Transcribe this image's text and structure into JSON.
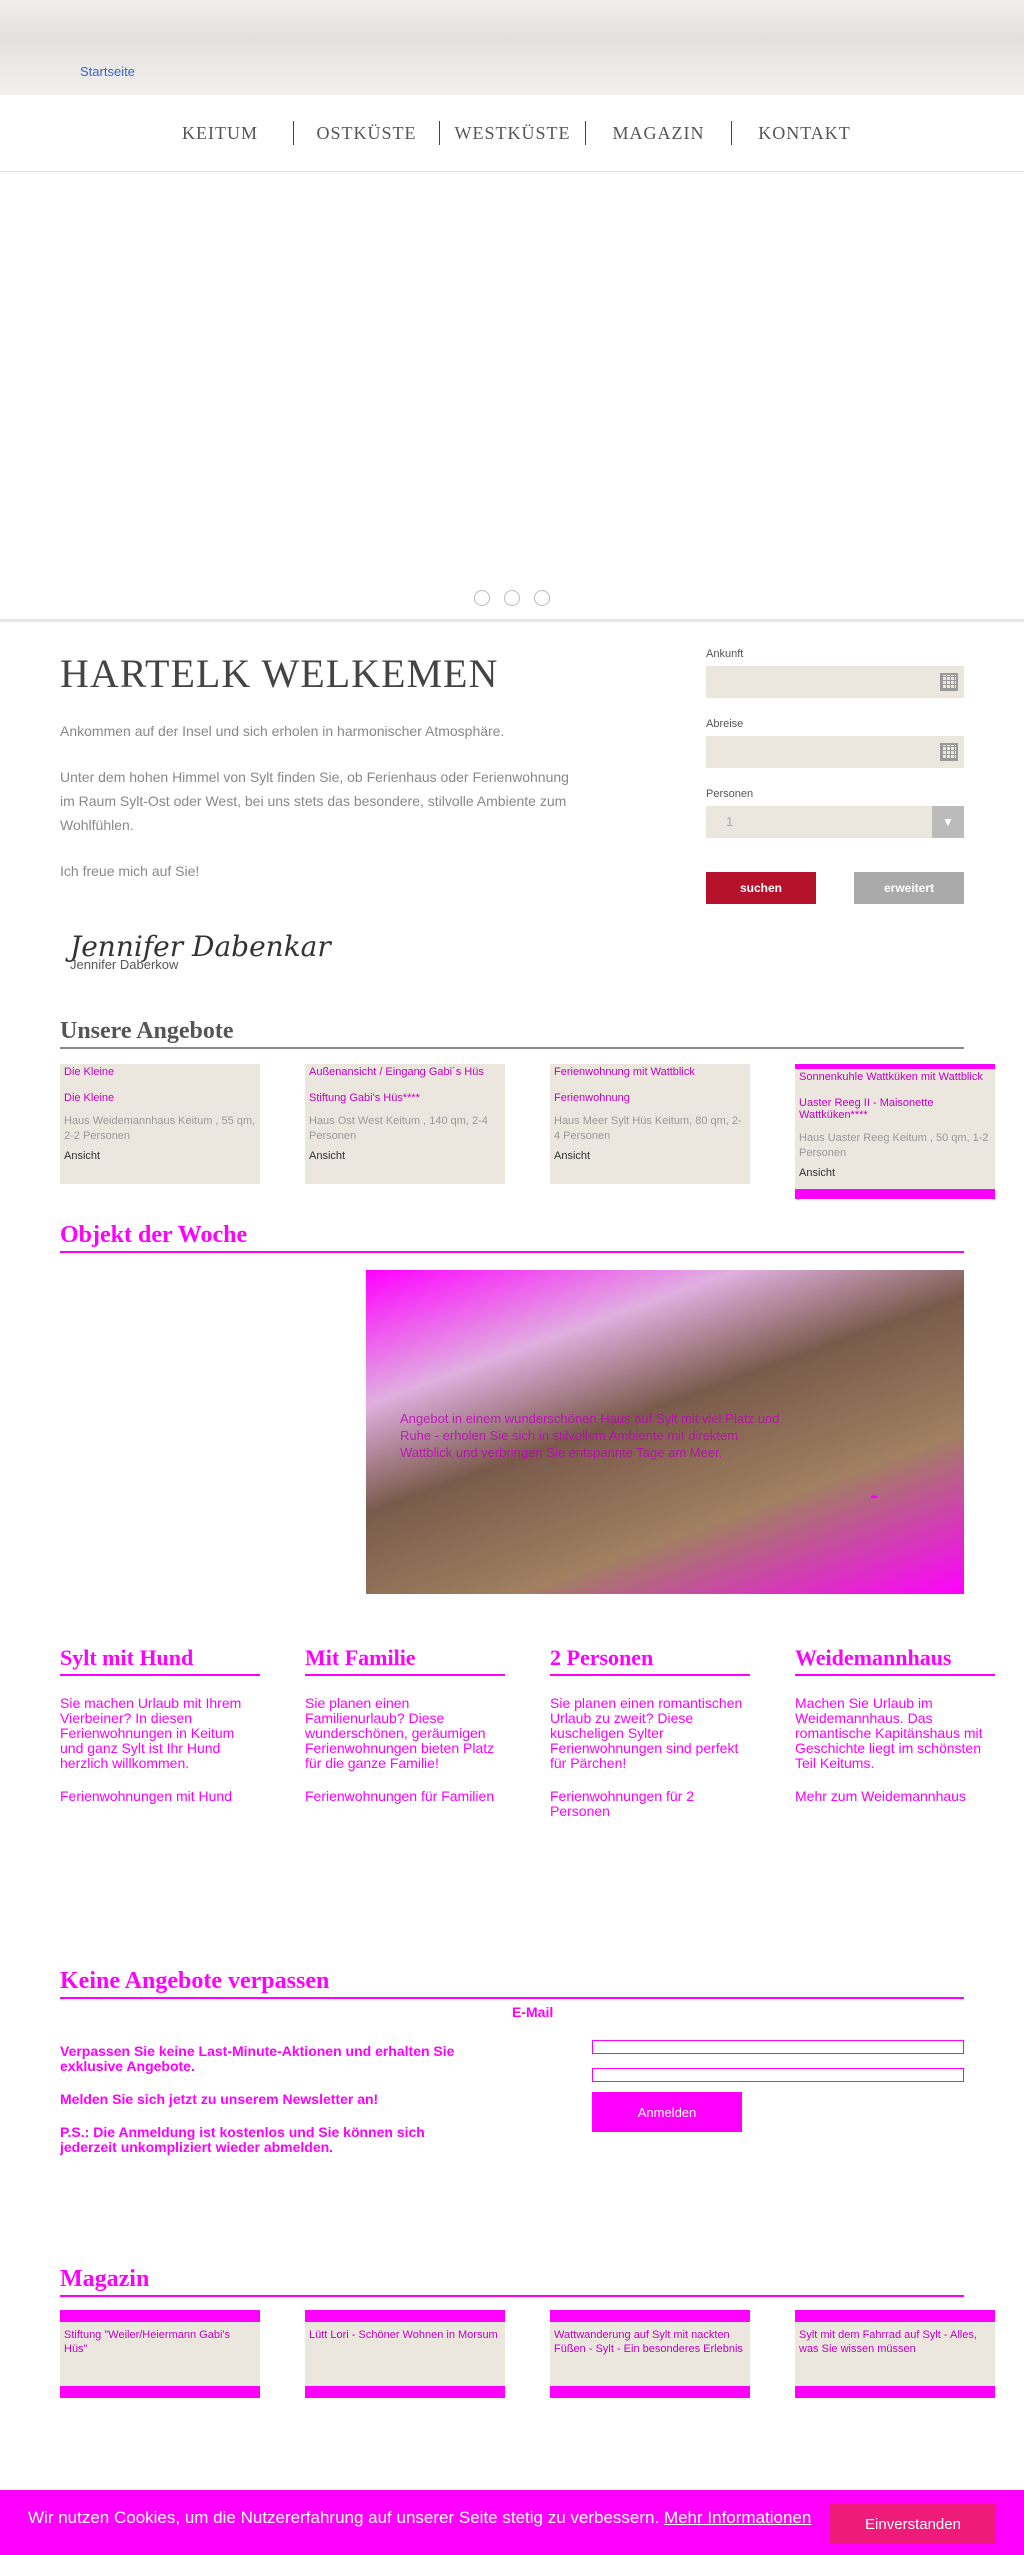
{
  "header": {
    "logo_alt": "Startseite"
  },
  "nav": [
    "KEITUM",
    "OSTKÜSTE",
    "WESTKÜSTE",
    "MAGAZIN",
    "KONTAKT"
  ],
  "welcome": {
    "title": "HARTELK WELKEMEN",
    "p1": "Ankommen auf der Insel und sich erholen in harmonischer Atmosphäre.",
    "p2": "Unter dem hohen Himmel von Sylt finden Sie, ob Ferienhaus oder Ferienwohnung im Raum Sylt-Ost oder West, bei uns stets das besondere, stilvolle Ambiente zum Wohlfühlen.",
    "p3": "Ich freue mich auf Sie!",
    "signature": "Jennifer Dabenkar",
    "signature_name": "Jennifer Daberkow"
  },
  "booking": {
    "arrival_label": "Ankunft",
    "departure_label": "Abreise",
    "persons_label": "Personen",
    "persons_value": "1",
    "search_button": "suchen",
    "advanced_button": "erweitert"
  },
  "offers": {
    "title": "Unsere Angebote",
    "items": [
      {
        "img_alt": "Die Kleine",
        "title": "Die Kleine",
        "desc": "Haus Weidemannhaus Keitum , 55 qm, 2-2 Personen",
        "more": "Ansicht"
      },
      {
        "img_alt": "Außenansicht / Eingang Gabi´s Hüs",
        "title": "Stiftung Gabi's Hüs****",
        "desc": "Haus Ost West Keitum , 140 qm, 2-4 Personen",
        "more": "Ansicht"
      },
      {
        "img_alt": "Ferienwohnung mit Wattblick",
        "title": "Ferienwohnung",
        "desc": "Haus Meer Sylt Hüs Keitum, 80 qm, 2-4 Personen",
        "more": "Ansicht"
      },
      {
        "img_alt": "Sonnenkuhle Wattküken mit Wattblick",
        "title": "Uaster Reeg II - Maisonette Wattküken****",
        "desc": "Haus Uaster Reeg Keitum , 50 qm, 1-2 Personen",
        "more": "Ansicht"
      }
    ]
  },
  "object_of_week": {
    "title": "Objekt der Woche",
    "text": "Angebot in einem wunderschönen Haus auf Sylt mit viel Platz und Ruhe - erholen Sie sich in stilvollem Ambiente mit direktem Wattblick und verbringen Sie entspannte Tage am Meer."
  },
  "features": [
    {
      "title": "Sylt mit Hund",
      "text": "Sie machen Urlaub mit Ihrem Vierbeiner? In diesen Ferienwohnungen in Keitum und ganz Sylt ist Ihr Hund herzlich willkommen.",
      "link": "Ferienwohnungen mit Hund"
    },
    {
      "title": "Mit Familie",
      "text": "Sie planen einen Familienurlaub? Diese wunderschönen, geräumigen Ferienwohnungen bieten Platz für die ganze Familie!",
      "link": "Ferienwohnungen für Familien"
    },
    {
      "title": "2 Personen",
      "text": "Sie planen einen romantischen Urlaub zu zweit? Diese kuscheligen Sylter Ferienwohnungen sind perfekt für Pärchen!",
      "link": "Ferienwohnungen für 2 Personen"
    },
    {
      "title": "Weidemannhaus",
      "text": "Machen Sie Urlaub im Weidemannhaus. Das romantische Kapitänshaus mit Geschichte liegt im schönsten Teil Keitums.",
      "link": "Mehr zum Weidemannhaus"
    }
  ],
  "newsletter": {
    "title": "Keine Angebote verpassen",
    "p1": "Verpassen Sie keine Last-Minute-Aktionen und erhalten Sie exklusive Angebote.",
    "p2": "Melden Sie sich jetzt zu unserem Newsletter an!",
    "p3": "P.S.: Die Anmeldung ist kostenlos und Sie können sich jederzeit unkompliziert wieder abmelden.",
    "email_label": "E-Mail",
    "button": "Anmelden"
  },
  "magazin": {
    "title": "Magazin",
    "items": [
      "Stiftung \"Weiler/Heiermann Gabi's Hüs\"",
      "Lütt Lori - Schöner Wohnen in Morsum",
      "Wattwanderung auf Sylt mit nackten Füßen - Sylt - Ein besonderes Erlebnis",
      "Sylt mit dem Fahrrad auf Sylt - Alles, was Sie wissen müssen"
    ]
  },
  "cookie": {
    "text": "Wir nutzen Cookies, um die Nutzererfahrung auf unserer Seite stetig zu verbessern.",
    "link": "Mehr Informationen",
    "button": "Einverstanden"
  }
}
